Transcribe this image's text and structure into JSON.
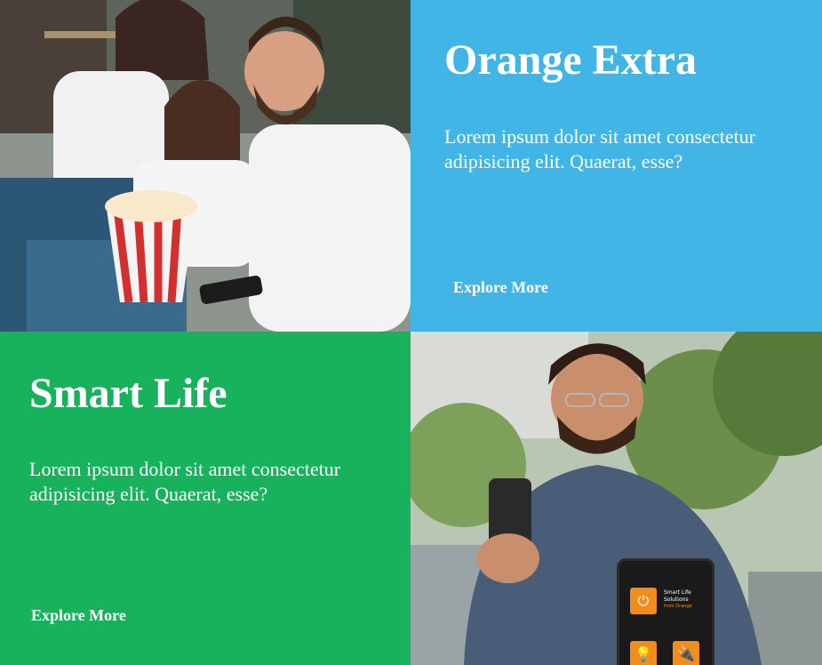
{
  "tiles": {
    "orange_extra": {
      "title": "Orange Extra",
      "text": "Lorem ipsum dolor sit amet consectetur adipisicing elit. Quaerat, esse?",
      "cta": "Explore More",
      "color": "#41b6e6"
    },
    "smart_life": {
      "title": "Smart Life",
      "text": "Lorem ipsum dolor sit amet consectetur adipisicing elit. Quaerat, esse?",
      "cta": "Explore More",
      "color": "#17b25b"
    },
    "phone_app": {
      "title": "Smart Life",
      "subtitle": "Solutions",
      "brand": "from Orange",
      "accent": "#f28c1c"
    }
  }
}
